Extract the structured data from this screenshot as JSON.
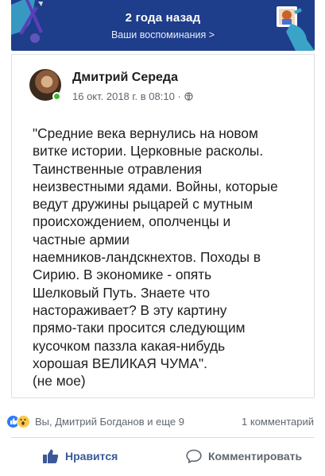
{
  "memory_banner": {
    "title": "2 года назад",
    "subtitle": "Ваши воспоминания >"
  },
  "post": {
    "author": "Дмитрий Середа",
    "date": "16 окт. 2018 г. в 08:10 · ",
    "privacy_icon": "globe-icon",
    "text": "\"Средние века вернулись на новом\nвитке истории. Церковные расколы.\nТаинственные отравления\nнеизвестными ядами. Войны, которые\nведут дружины рыцарей с мутным\nпроисхождением, ополченцы и\nчастные армии\nнаемников-ландскнехтов. Походы в\nСирию. В экономике - опять\nШелковый Путь. Знаете что\nнастораживает? В эту картину\nпрямо-таки просится следующим\nкусочком паззла  какая-нибудь\nхорошая ВЕЛИКАЯ ЧУМА\".\n(не мое)"
  },
  "reactions": {
    "reactors": "Вы, Дмитрий Богданов и еще 9",
    "comments": "1 комментарий"
  },
  "actions": {
    "like_label": "Нравится",
    "comment_label": "Комментировать"
  },
  "colors": {
    "banner": "#1e3d8a",
    "like_blue": "#3b5998",
    "online": "#42b72a"
  }
}
